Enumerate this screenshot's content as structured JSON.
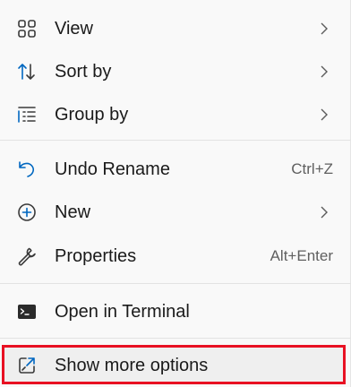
{
  "menu": {
    "items": [
      {
        "label": "View",
        "icon": "grid-view-icon",
        "submenu": true
      },
      {
        "label": "Sort by",
        "icon": "sort-arrows-icon",
        "submenu": true
      },
      {
        "label": "Group by",
        "icon": "group-list-icon",
        "submenu": true
      },
      {
        "label": "Undo Rename",
        "icon": "undo-icon",
        "shortcut": "Ctrl+Z"
      },
      {
        "label": "New",
        "icon": "add-circle-icon",
        "submenu": true
      },
      {
        "label": "Properties",
        "icon": "wrench-icon",
        "shortcut": "Alt+Enter"
      },
      {
        "label": "Open in Terminal",
        "icon": "terminal-icon"
      },
      {
        "label": "Show more options",
        "icon": "open-external-icon",
        "highlighted": true
      }
    ]
  },
  "colors": {
    "accent_blue": "#0067c0",
    "highlight_border": "#e81123",
    "menu_background": "#f9f9f9"
  }
}
